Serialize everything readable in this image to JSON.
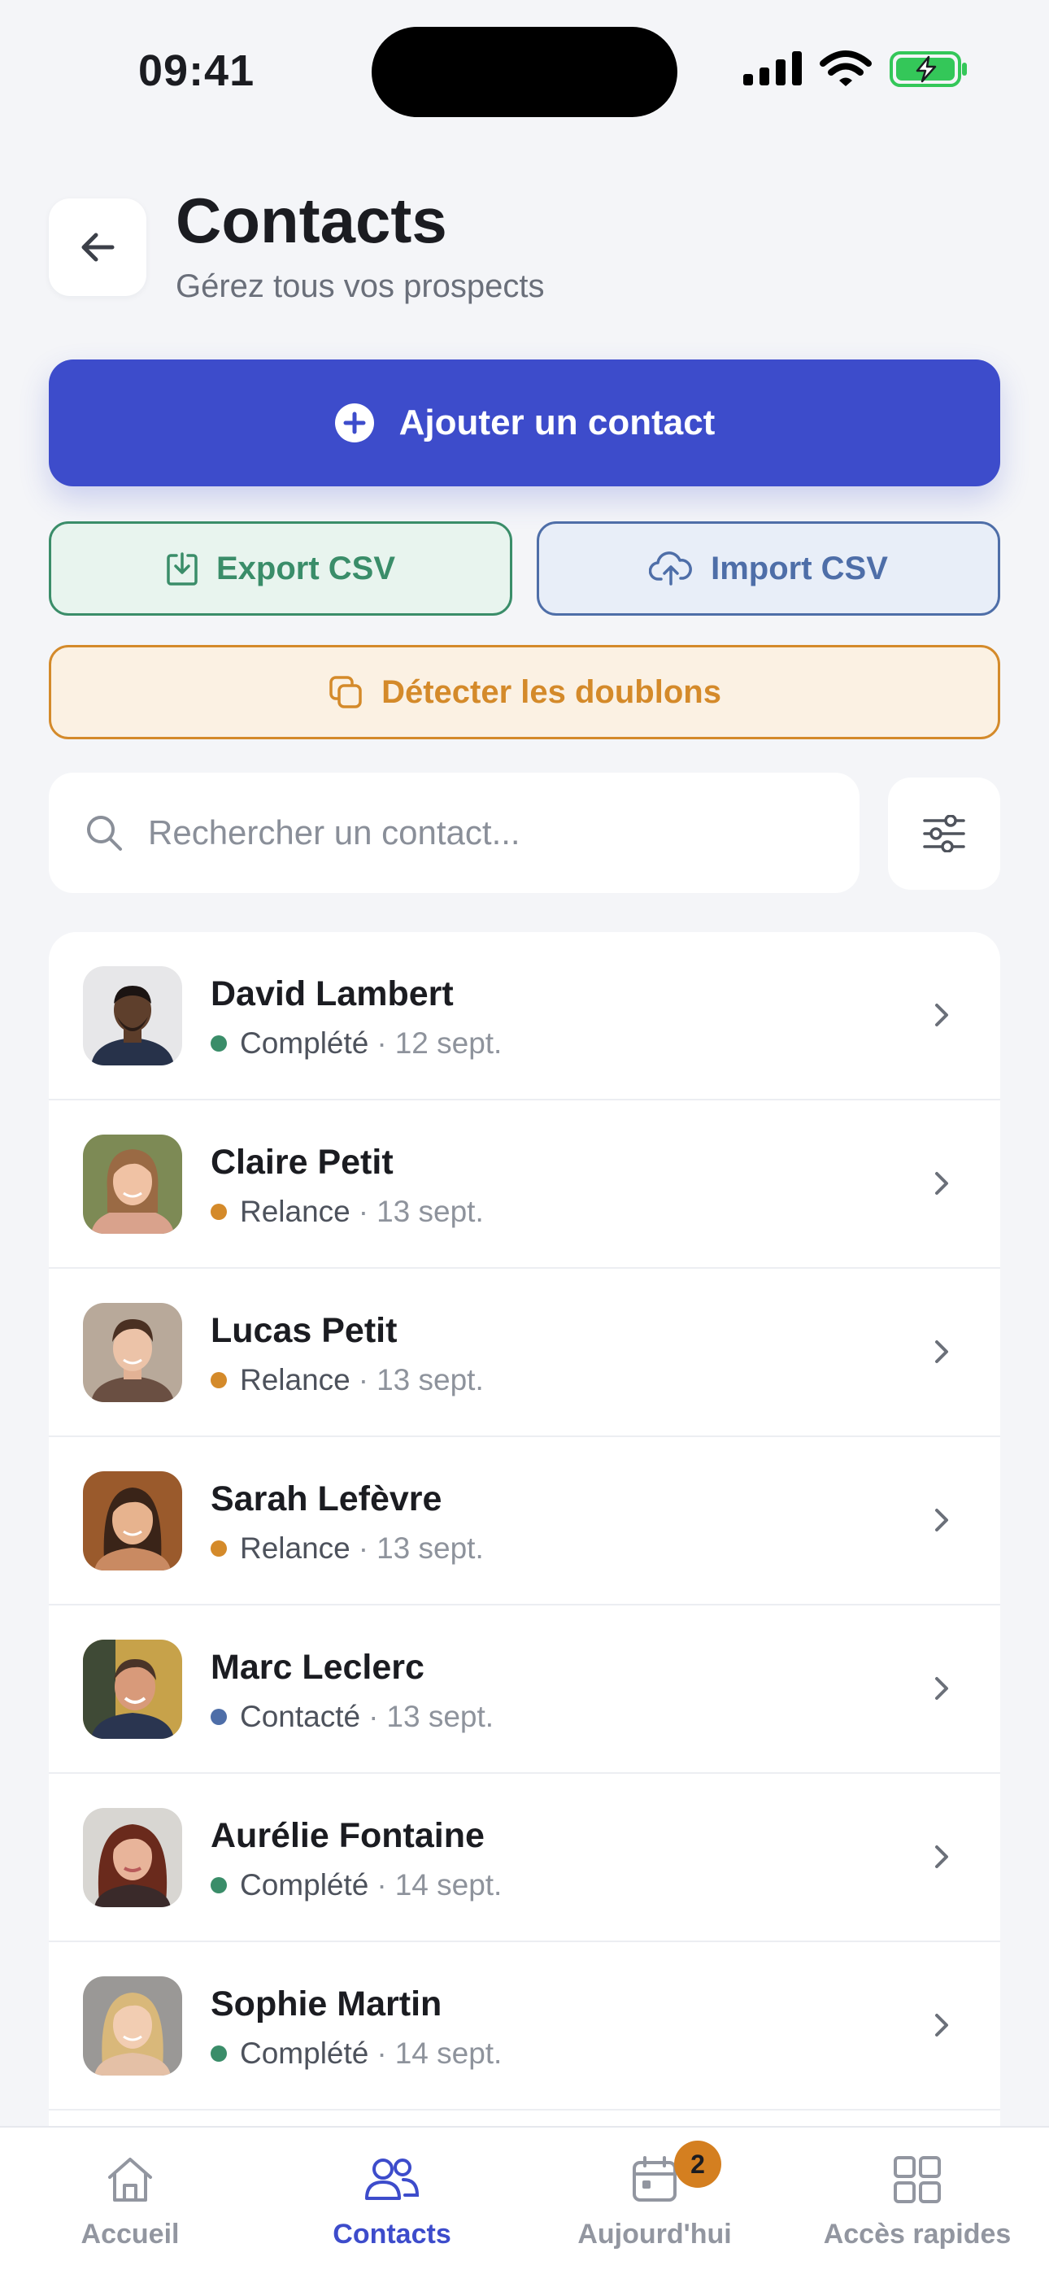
{
  "status_bar": {
    "time": "09:41"
  },
  "header": {
    "title": "Contacts",
    "subtitle": "Gérez tous vos prospects"
  },
  "actions": {
    "add_label": "Ajouter un contact",
    "export_label": "Export CSV",
    "import_label": "Import CSV",
    "duplicates_label": "Détecter les doublons"
  },
  "search": {
    "placeholder": "Rechercher un contact...",
    "value": ""
  },
  "status_colors": {
    "Complété": "#3a8d69",
    "Relance": "#d48a2a",
    "Contacté": "#4e6ea8"
  },
  "contacts": [
    {
      "name": "David Lambert",
      "status": "Complété",
      "separator": "·",
      "date": "12 sept."
    },
    {
      "name": "Claire Petit",
      "status": "Relance",
      "separator": "·",
      "date": "13 sept."
    },
    {
      "name": "Lucas Petit",
      "status": "Relance",
      "separator": "·",
      "date": "13 sept."
    },
    {
      "name": "Sarah Lefèvre",
      "status": "Relance",
      "separator": "·",
      "date": "13 sept."
    },
    {
      "name": "Marc Leclerc",
      "status": "Contacté",
      "separator": "·",
      "date": "13 sept."
    },
    {
      "name": "Aurélie Fontaine",
      "status": "Complété",
      "separator": "·",
      "date": "14 sept."
    },
    {
      "name": "Sophie Martin",
      "status": "Complété",
      "separator": "·",
      "date": "14 sept."
    }
  ],
  "nav": {
    "items": [
      {
        "label": "Accueil",
        "icon": "home-icon"
      },
      {
        "label": "Contacts",
        "icon": "contacts-icon",
        "active": true
      },
      {
        "label": "Aujourd'hui",
        "icon": "calendar-icon",
        "badge": "2"
      },
      {
        "label": "Accès rapides",
        "icon": "grid-icon"
      }
    ]
  },
  "colors": {
    "primary": "#3d4ccb",
    "background": "#f4f5f8"
  }
}
